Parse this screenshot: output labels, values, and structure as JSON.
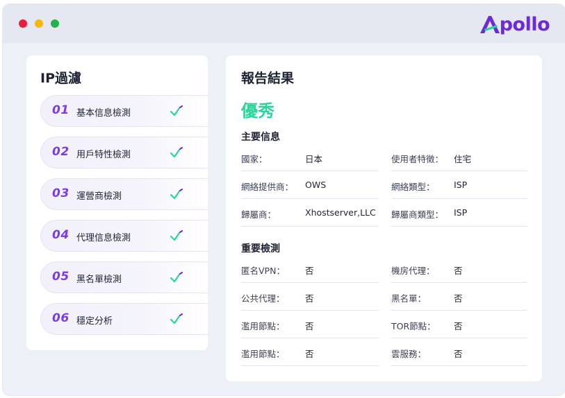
{
  "brand": {
    "name": "pollo",
    "accent": "#6b2bd9",
    "mark_color": "#2fd39a"
  },
  "window_controls": [
    {
      "name": "close",
      "color": "#ec1c3b"
    },
    {
      "name": "minimize",
      "color": "#f5b90a"
    },
    {
      "name": "maximize",
      "color": "#22b24c"
    }
  ],
  "left_panel": {
    "title": "IP過濾",
    "steps": [
      {
        "num": "01",
        "label": "基本信息檢測",
        "icon": "check-icon"
      },
      {
        "num": "02",
        "label": "用戶特性檢測",
        "icon": "check-icon"
      },
      {
        "num": "03",
        "label": "運營商檢測",
        "icon": "check-icon"
      },
      {
        "num": "04",
        "label": "代理信息檢測",
        "icon": "check-icon"
      },
      {
        "num": "05",
        "label": "黑名單檢測",
        "icon": "check-icon"
      },
      {
        "num": "06",
        "label": "穩定分析",
        "icon": "check-icon"
      }
    ]
  },
  "report": {
    "title": "報告結果",
    "grade": "優秀",
    "grade_color": "#2fd39a",
    "main_info": {
      "heading": "主要信息",
      "rows": [
        [
          {
            "k": "國家：",
            "v": "日本"
          },
          {
            "k": "使用者特徵：",
            "v": "住宅"
          }
        ],
        [
          {
            "k": "網絡提供商：",
            "v": "OWS"
          },
          {
            "k": "網絡類型：",
            "v": "ISP"
          }
        ],
        [
          {
            "k": "歸屬商：",
            "v": "Xhostserver,LLC"
          },
          {
            "k": "歸屬商類型：",
            "v": "ISP"
          }
        ]
      ]
    },
    "checks": {
      "heading": "重要檢測",
      "rows": [
        [
          {
            "k": "匿名VPN：",
            "v": "否"
          },
          {
            "k": "機房代理：",
            "v": "否"
          }
        ],
        [
          {
            "k": "公共代理：",
            "v": "否"
          },
          {
            "k": "黑名單：",
            "v": "否"
          }
        ],
        [
          {
            "k": "濫用節點：",
            "v": "否"
          },
          {
            "k": "TOR節點：",
            "v": "否"
          }
        ],
        [
          {
            "k": "濫用節點：",
            "v": "否"
          },
          {
            "k": "雲服務：",
            "v": "否"
          }
        ]
      ]
    }
  }
}
